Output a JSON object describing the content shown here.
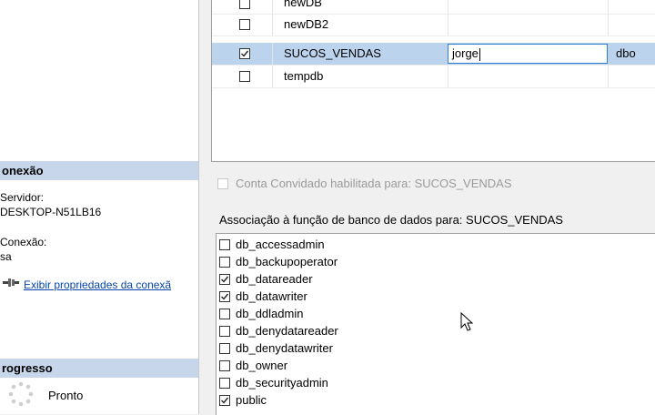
{
  "sidebar": {
    "connection_header": "onexão",
    "server_label": "Servidor:",
    "server_value": "DESKTOP-N51LB16",
    "connection_label": "Conexão:",
    "connection_value": "sa",
    "properties_link": "Exibir propriedades da conexã",
    "progress_header": "rogresso",
    "progress_status": "Pronto"
  },
  "db_grid": {
    "rows": [
      {
        "db": "newDB",
        "user": "",
        "schema": "",
        "checked": false
      },
      {
        "db": "newDB2",
        "user": "",
        "schema": "",
        "checked": false
      },
      {
        "db": "SUCOS_VENDAS",
        "user": "jorge",
        "schema": "dbo",
        "checked": true
      },
      {
        "db": "tempdb",
        "user": "",
        "schema": "",
        "checked": false
      }
    ]
  },
  "guest_account_label": "Conta Convidado habilitada para: SUCOS_VENDAS",
  "role_association_label": "Associação à função de banco de dados para: SUCOS_VENDAS",
  "roles": [
    {
      "name": "db_accessadmin",
      "checked": false
    },
    {
      "name": "db_backupoperator",
      "checked": false
    },
    {
      "name": "db_datareader",
      "checked": true
    },
    {
      "name": "db_datawriter",
      "checked": true
    },
    {
      "name": "db_ddladmin",
      "checked": false
    },
    {
      "name": "db_denydatareader",
      "checked": false
    },
    {
      "name": "db_denydatawriter",
      "checked": false
    },
    {
      "name": "db_owner",
      "checked": false
    },
    {
      "name": "db_securityadmin",
      "checked": false
    },
    {
      "name": "public",
      "checked": true
    }
  ],
  "colors": {
    "header_bg": "#c7d6ea",
    "selected_row": "#bcd3ee",
    "link": "#0645ad"
  }
}
